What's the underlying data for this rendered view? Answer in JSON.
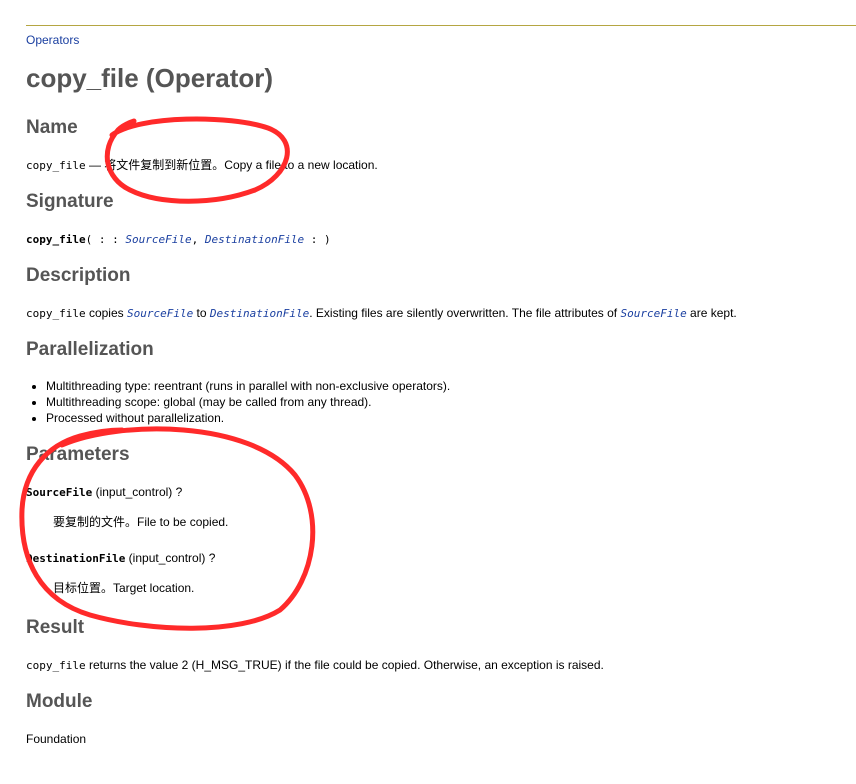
{
  "breadcrumb": {
    "label": "Operators"
  },
  "page": {
    "title": "copy_file (Operator)"
  },
  "sections": {
    "name": {
      "heading": "Name",
      "op": "copy_file",
      "dash": " — ",
      "cn": "将文件复制到新位置。",
      "en": "Copy a file to a new location."
    },
    "signature": {
      "heading": "Signature",
      "op": "copy_file",
      "open": "( : : ",
      "param1": "SourceFile",
      "comma": ", ",
      "param2": "DestinationFile",
      "close": " : )"
    },
    "description": {
      "heading": "Description",
      "op": "copy_file",
      "t1": " copies ",
      "param1": "SourceFile",
      "t2": " to ",
      "param2": "DestinationFile",
      "t3": ". Existing files are silently overwritten. The file attributes of ",
      "param3": "SourceFile",
      "t4": " are kept."
    },
    "parallelization": {
      "heading": "Parallelization",
      "items": [
        "Multithreading type: reentrant (runs in parallel with non-exclusive operators).",
        "Multithreading scope: global (may be called from any thread).",
        "Processed without parallelization."
      ]
    },
    "parameters": {
      "heading": "Parameters",
      "items": [
        {
          "name": "SourceFile",
          "type": " (input_control) ",
          "q": "?",
          "desc": "要复制的文件。File to be copied."
        },
        {
          "name": "DestinationFile",
          "type": " (input_control) ",
          "q": "?",
          "desc": "目标位置。Target location."
        }
      ]
    },
    "result": {
      "heading": "Result",
      "op": "copy_file",
      "text": " returns the value 2 (H_MSG_TRUE) if the file could be copied. Otherwise, an exception is raised."
    },
    "module": {
      "heading": "Module",
      "value": "Foundation"
    }
  },
  "colors": {
    "link": "#1a3fa0",
    "heading": "#555555",
    "rule": "#b5a642",
    "annotation": "#ff2a2a"
  }
}
